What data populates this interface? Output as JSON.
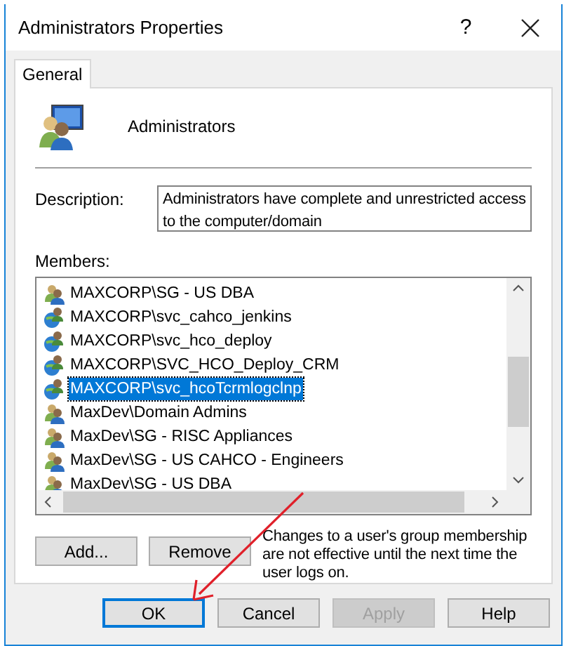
{
  "window": {
    "title": "Administrators Properties",
    "help": "?"
  },
  "tabs": [
    {
      "label": "General",
      "selected": true
    }
  ],
  "group": {
    "name": "Administrators"
  },
  "description": {
    "label": "Description:",
    "value": "Administrators have complete and unrestricted access to the computer/domain"
  },
  "members": {
    "label": "Members:",
    "items": [
      {
        "name": "MAXCORP\\SG - US DBA",
        "kind": "group",
        "selected": false
      },
      {
        "name": "MAXCORP\\svc_cahco_jenkins",
        "kind": "user",
        "selected": false
      },
      {
        "name": "MAXCORP\\svc_hco_deploy",
        "kind": "user",
        "selected": false
      },
      {
        "name": "MAXCORP\\SVC_HCO_Deploy_CRM",
        "kind": "user",
        "selected": false
      },
      {
        "name": "MAXCORP\\svc_hcoTcrmlogclnp",
        "kind": "user",
        "selected": true
      },
      {
        "name": "MaxDev\\Domain Admins",
        "kind": "group",
        "selected": false
      },
      {
        "name": "MaxDev\\SG - RISC Appliances",
        "kind": "group",
        "selected": false
      },
      {
        "name": "MaxDev\\SG - US CAHCO - Engineers",
        "kind": "group",
        "selected": false
      },
      {
        "name": "MaxDev\\SG - US DBA",
        "kind": "group",
        "selected": false
      }
    ]
  },
  "member_buttons": [
    "Add...",
    "Remove"
  ],
  "note": "Changes to a user's group membership are not effective until the next time the user logs on.",
  "footer_buttons": [
    {
      "label": "OK",
      "default": true,
      "disabled": false
    },
    {
      "label": "Cancel",
      "default": false,
      "disabled": false
    },
    {
      "label": "Apply",
      "default": false,
      "disabled": true
    },
    {
      "label": "Help",
      "default": false,
      "disabled": false
    }
  ]
}
